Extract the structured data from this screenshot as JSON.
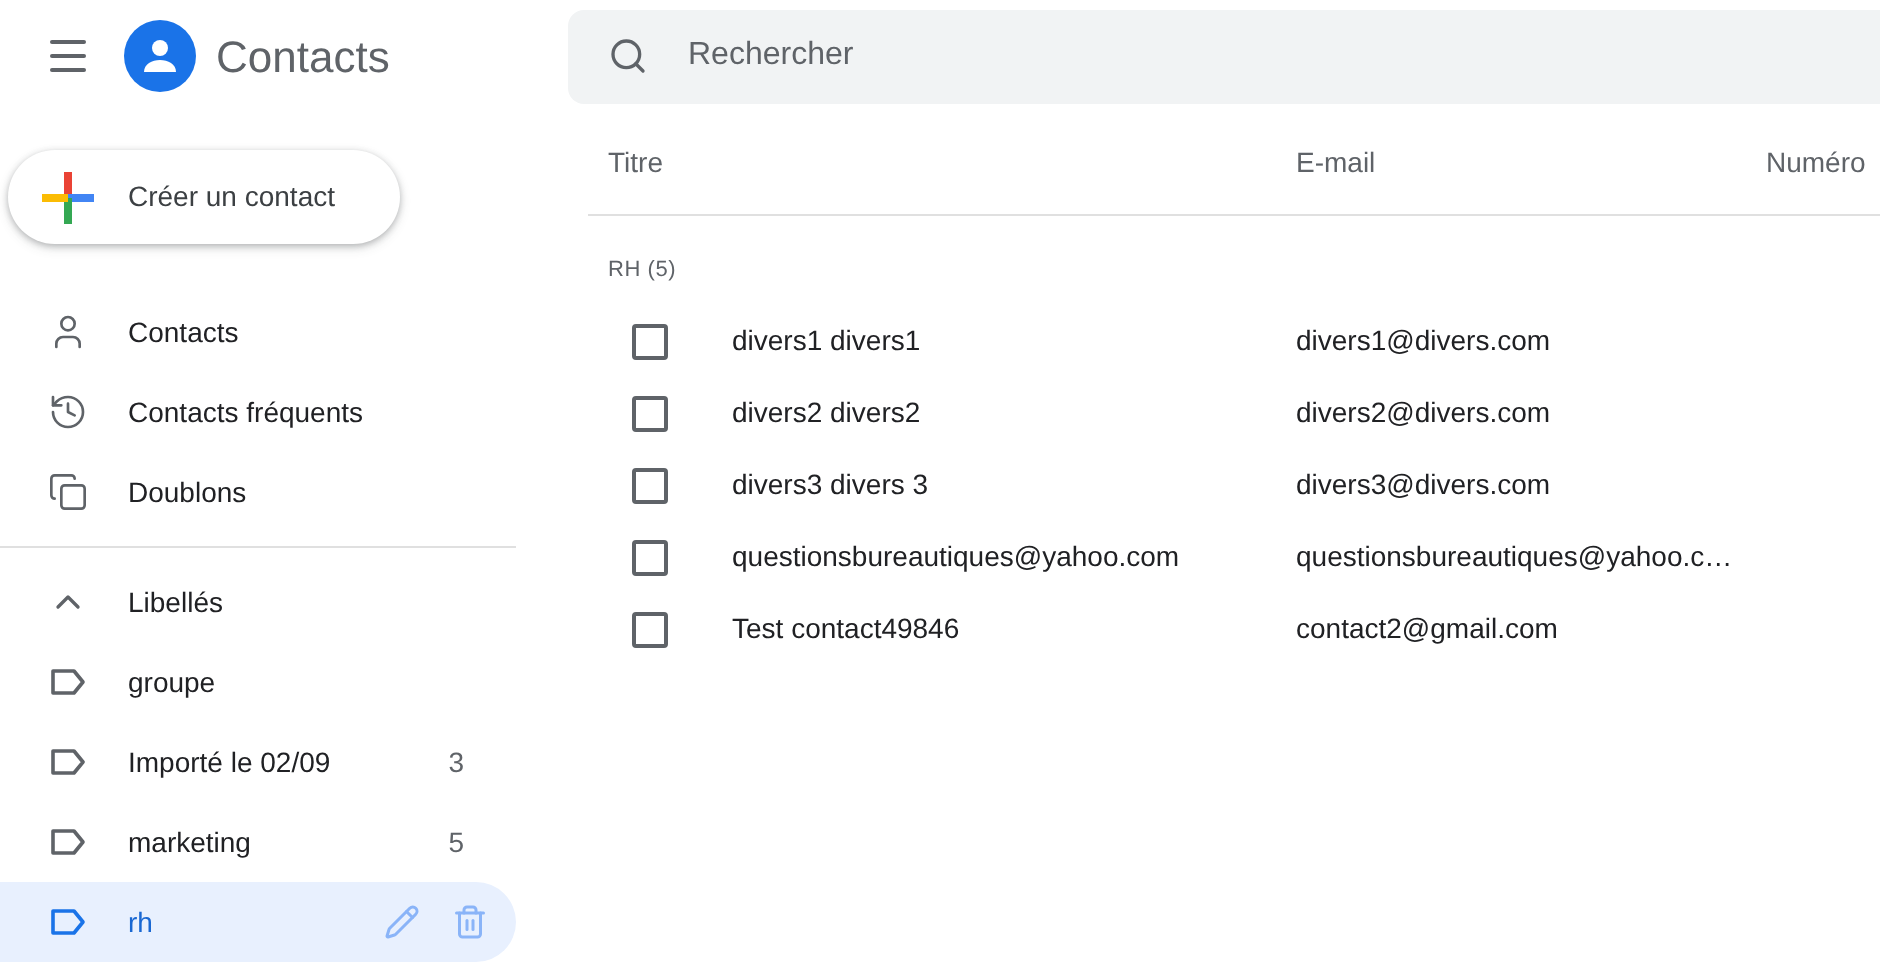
{
  "app": {
    "title": "Contacts"
  },
  "create_button": {
    "label": "Créer un contact"
  },
  "search": {
    "placeholder": "Rechercher"
  },
  "nav": {
    "items": [
      {
        "label": "Contacts",
        "kind": "person",
        "selected": false
      },
      {
        "label": "Contacts fréquents",
        "kind": "history",
        "selected": false
      },
      {
        "label": "Doublons",
        "kind": "duplicates",
        "selected": false
      }
    ]
  },
  "labels": {
    "title": "Libellés",
    "expanded": true,
    "items": [
      {
        "label": "groupe",
        "selected": false
      },
      {
        "label": "Importé le 02/09",
        "count": "3",
        "selected": false
      },
      {
        "label": "marketing",
        "count": "5",
        "selected": false
      },
      {
        "label": "rh",
        "selected": true
      }
    ]
  },
  "table": {
    "columns": [
      "Titre",
      "E-mail",
      "Numéro"
    ],
    "group": "RH (5)",
    "rows": [
      {
        "name": "divers1 divers1",
        "email": "divers1@divers.com",
        "checked": false
      },
      {
        "name": "divers2 divers2",
        "email": "divers2@divers.com",
        "checked": false
      },
      {
        "name": "divers3 divers 3",
        "email": "divers3@divers.com",
        "checked": false
      },
      {
        "name": "questionsbureautiques@yahoo.com",
        "email": "questionsbureautiques@yahoo.c…",
        "checked": false
      },
      {
        "name": "Test contact49846",
        "email": "contact2@gmail.com",
        "checked": false
      }
    ]
  }
}
